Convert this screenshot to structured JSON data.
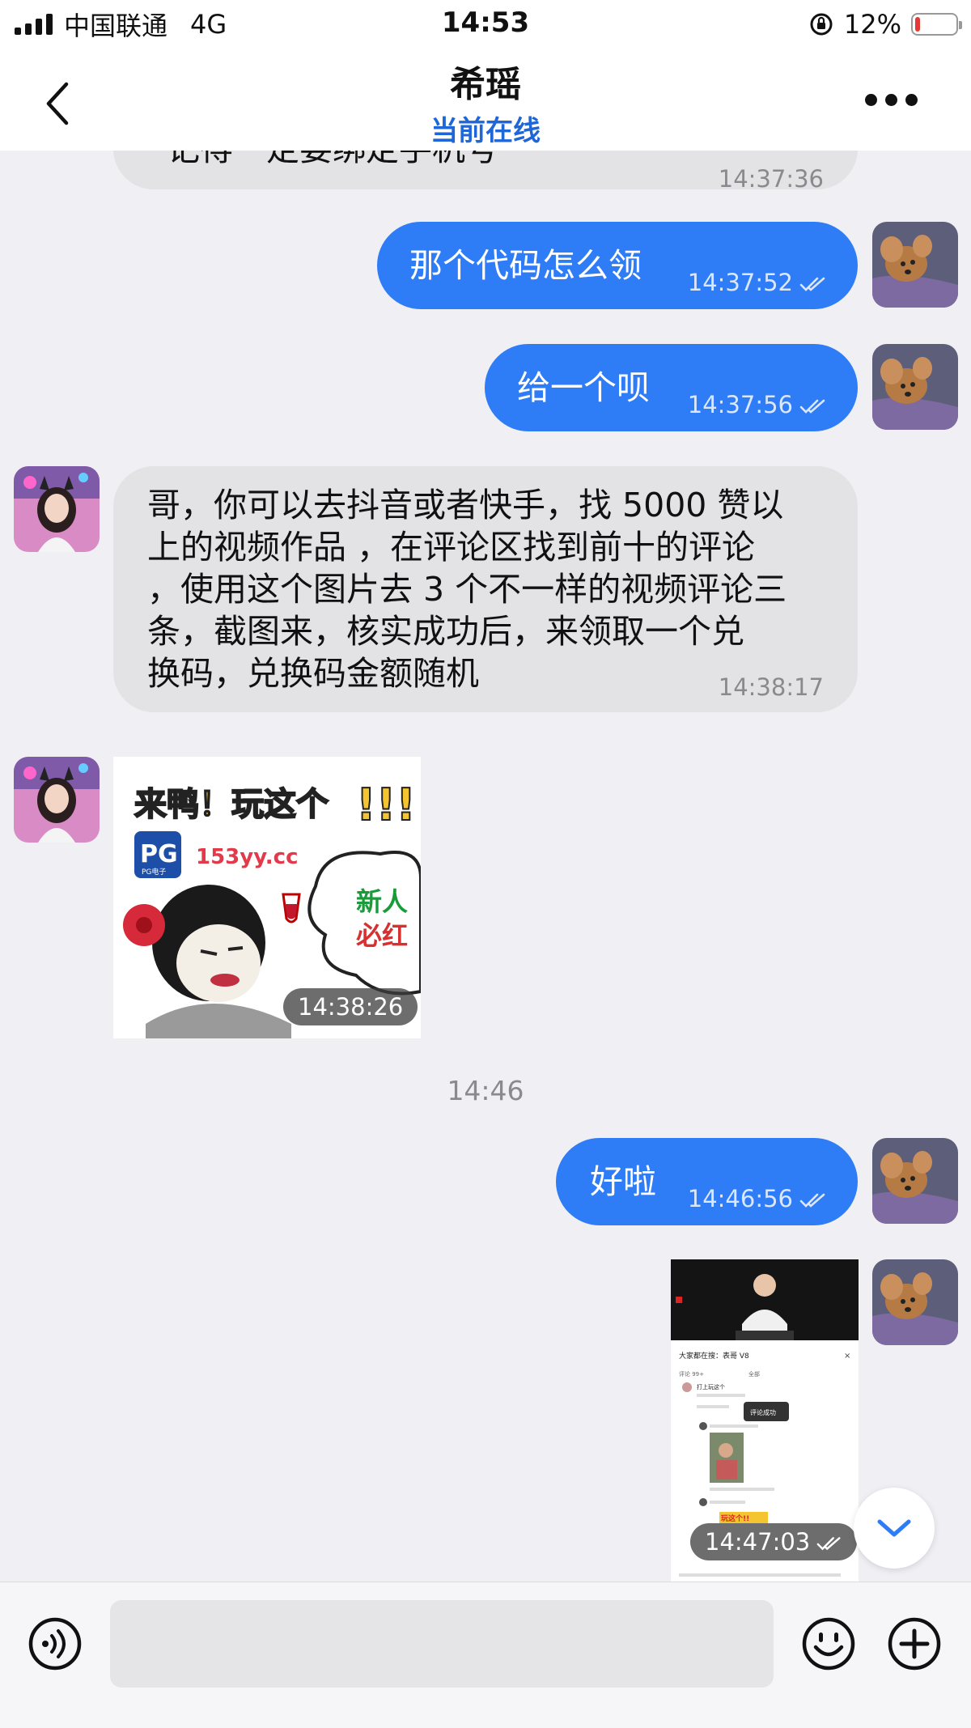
{
  "status_bar": {
    "carrier": "中国联通",
    "network": "4G",
    "time": "14:53",
    "battery": "12%",
    "battery_level": 0.12
  },
  "header": {
    "title": "希瑶",
    "status": "当前在线"
  },
  "messages": [
    {
      "from": "contact",
      "text": "记得一定要绑定手机号",
      "time": "14:37:36"
    },
    {
      "from": "me",
      "text": "那个代码怎么领",
      "time": "14:37:52"
    },
    {
      "from": "me",
      "text": "给一个呗",
      "time": "14:37:56"
    },
    {
      "from": "contact",
      "lines": [
        "哥，你可以去抖音或者快手，找 5000 赞以",
        "上的视频作品 ，在评论区找到前十的评论",
        "，使用这个图片去 3 个不一样的视频评论三",
        "条，截图来，核实成功后，来领取一个兑",
        "换码，兑换码金额随机"
      ],
      "time": "14:38:17"
    },
    {
      "from": "contact",
      "type": "image",
      "image": {
        "headline": "来鸭！玩这个",
        "exclaim": "!!!",
        "logo": "PG",
        "logo_sub": "PG电子",
        "site": "153yy.cc",
        "badge_line1": "新人",
        "badge_line2": "必红"
      },
      "time": "14:38:26"
    },
    {
      "from": "me",
      "text": "好啦",
      "time": "14:46:56"
    },
    {
      "from": "me",
      "type": "image",
      "image": {
        "comment_header": "大家都在搜：表哥 V8",
        "like_count": "评论 99+",
        "comments_label": "全部",
        "comment_line": "打上玩这个",
        "toast": "评论成功",
        "sticker": "玩这个!!"
      },
      "time": "14:47:03"
    }
  ],
  "day_separator": "14:46",
  "input": {
    "placeholder": ""
  },
  "colors": {
    "accent": "#2e7cf6",
    "online": "#1f66d6",
    "incoming_bubble": "#e3e3e6",
    "background": "#efeff4"
  },
  "icons": {
    "back": "chevron-left-icon",
    "more": "ellipsis-icon",
    "voice": "voice-icon",
    "emoji": "emoji-icon",
    "plus": "plus-icon",
    "scroll": "chevron-down-icon"
  }
}
